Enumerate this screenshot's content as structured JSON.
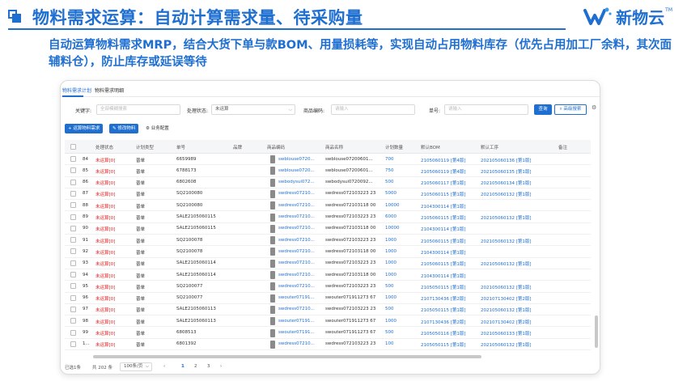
{
  "slide": {
    "title": "物料需求运算：自动计算需求量、待采购量",
    "subtitle": "自动运算物料需求MRP，结合大货下单与款BOM、用量损耗等，实现自动占用物料库存（优先占用加工厂余料，其次面辅料仓），防止库存或延误等待",
    "brand_name": "新物云",
    "brand_tm": "TM",
    "accent": "#1f6fd1"
  },
  "app": {
    "tabs": [
      "物料需求计划",
      "物料需求明细"
    ],
    "filters": {
      "keyword_label": "关键字:",
      "keyword_placeholder": "全部模糊搜索",
      "status_label": "处理状态:",
      "status_value": "未运算",
      "material_label": "商品编码:",
      "material_placeholder": "请输入",
      "order_label": "单号:",
      "order_placeholder": "请输入",
      "query_button": "查询",
      "advanced_button": "高级搜索"
    },
    "toolbar": {
      "run_button": "运算物料需求",
      "edit_button": "修改物料",
      "config_label": "业务配置"
    },
    "columns": [
      "处理状态",
      "计划类型",
      "单号",
      "品牌",
      "商品编码",
      "商品名称",
      "计划数量",
      "默认BOM",
      "默认工序",
      "备注"
    ],
    "rows": [
      {
        "no": "84",
        "status": "未运算[0]",
        "type": "普单",
        "order": "6659989",
        "code": "swblouse0720...",
        "name": "swblouse07200601...",
        "qty": "700",
        "bom": "2105060119 [第4版]",
        "process": "202105060136 [第1版]"
      },
      {
        "no": "85",
        "status": "未运算[0]",
        "type": "普单",
        "order": "6788173",
        "code": "swblouse0720...",
        "name": "swblouse07200601...",
        "qty": "750",
        "bom": "2105060119 [第4版]",
        "process": "202105060135 [第1版]"
      },
      {
        "no": "86",
        "status": "未运算[0]",
        "type": "普单",
        "order": "6802608",
        "code": "swbodysui072...",
        "name": "swbodysui0720092...",
        "qty": "500",
        "bom": "2105060117 [第1版]",
        "process": "202105060134 [第1版]"
      },
      {
        "no": "87",
        "status": "未运算[0]",
        "type": "普单",
        "order": "SQ2100080",
        "code": "swdress07210...",
        "name": "swdress072103223 23",
        "qty": "5000",
        "bom": "2105060115 [第1版]",
        "process": "202105060132 [第1版]"
      },
      {
        "no": "88",
        "status": "未运算[0]",
        "type": "普单",
        "order": "SQ2100080",
        "code": "swdress07210...",
        "name": "swdress072103118 00",
        "qty": "10000",
        "bom": "2104300114 [第1版]",
        "process": ""
      },
      {
        "no": "89",
        "status": "未运算[0]",
        "type": "普单",
        "order": "SALE2105060115",
        "code": "swdress07210...",
        "name": "swdress072103223 23",
        "qty": "6000",
        "bom": "2105060115 [第1版]",
        "process": "202105060132 [第1版]"
      },
      {
        "no": "90",
        "status": "未运算[0]",
        "type": "普单",
        "order": "SALE2105060115",
        "code": "swdress07210...",
        "name": "swdress072103118 00",
        "qty": "10000",
        "bom": "2104300114 [第1版]",
        "process": ""
      },
      {
        "no": "91",
        "status": "未运算[0]",
        "type": "普单",
        "order": "SQ2100078",
        "code": "swdress07210...",
        "name": "swdress072103223 23",
        "qty": "1000",
        "bom": "2105060115 [第1版]",
        "process": "202105060132 [第1版]"
      },
      {
        "no": "92",
        "status": "未运算[0]",
        "type": "普单",
        "order": "SQ2100078",
        "code": "swdress07210...",
        "name": "swdress072103118 00",
        "qty": "1000",
        "bom": "2104300114 [第1版]",
        "process": ""
      },
      {
        "no": "93",
        "status": "未运算[0]",
        "type": "普单",
        "order": "SALE2105060114",
        "code": "swdress07210...",
        "name": "swdress072103223 23",
        "qty": "1000",
        "bom": "2105060115 [第1版]",
        "process": "202105060132 [第1版]"
      },
      {
        "no": "94",
        "status": "未运算[0]",
        "type": "普单",
        "order": "SALE2105060114",
        "code": "swdress07210...",
        "name": "swdress072103118 00",
        "qty": "1000",
        "bom": "2104300114 [第1版]",
        "process": ""
      },
      {
        "no": "95",
        "status": "未运算[0]",
        "type": "普单",
        "order": "SQ2100077",
        "code": "swdress07210...",
        "name": "swdress072103223 23",
        "qty": "500",
        "bom": "2105050115 [第1版]",
        "process": "202105060132 [第1版]"
      },
      {
        "no": "96",
        "status": "未运算[0]",
        "type": "普单",
        "order": "SQ2100077",
        "code": "swouter07191...",
        "name": "swouter071911273 67",
        "qty": "1000",
        "bom": "2107130436 [第2版]",
        "process": "202107130402 [第2版]"
      },
      {
        "no": "97",
        "status": "未运算[0]",
        "type": "普单",
        "order": "SALE2105060113",
        "code": "swdress07210...",
        "name": "swdress072103223 23",
        "qty": "500",
        "bom": "2105050115 [第1版]",
        "process": "202105060132 [第1版]"
      },
      {
        "no": "98",
        "status": "未运算[0]",
        "type": "普单",
        "order": "SALE2105060113",
        "code": "swouter07191...",
        "name": "swouter071911273 67",
        "qty": "1000",
        "bom": "2107130436 [第2版]",
        "process": "202107130402 [第2版]"
      },
      {
        "no": "99",
        "status": "未运算[0]",
        "type": "普单",
        "order": "6808513",
        "code": "swouter07191...",
        "name": "swouter071911273 67",
        "qty": "500",
        "bom": "2105050116 [第1版]",
        "process": "202105060133 [第1版]"
      },
      {
        "no": "1...",
        "status": "未运算[0]",
        "type": "普单",
        "order": "6801392",
        "code": "swdress07210...",
        "name": "swdress072103223 23",
        "qty": "100",
        "bom": "2105050115 [第1版]",
        "process": "202105060132 [第1版]"
      }
    ],
    "pager": {
      "selected": "已选1条",
      "total": "共 202 条",
      "page_size": "100条/页",
      "prev": "‹",
      "pages": [
        "1",
        "2",
        "3"
      ],
      "next": "›"
    }
  }
}
